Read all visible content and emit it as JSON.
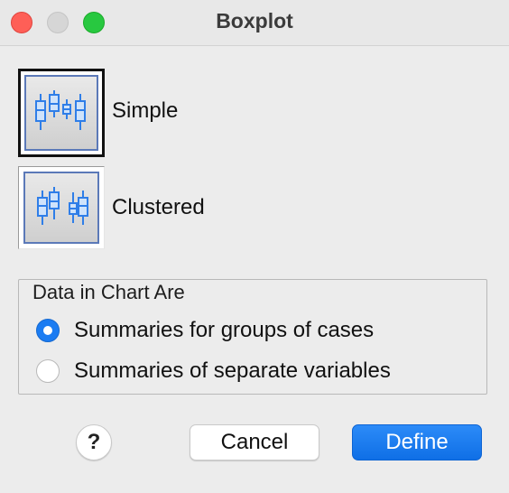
{
  "window": {
    "title": "Boxplot"
  },
  "chart_types": [
    {
      "label": "Simple",
      "selected": true,
      "icon": "simple-boxplot-icon"
    },
    {
      "label": "Clustered",
      "selected": false,
      "icon": "clustered-boxplot-icon"
    }
  ],
  "data_group": {
    "legend": "Data in Chart Are",
    "options": [
      {
        "label": "Summaries for groups of cases",
        "selected": true
      },
      {
        "label": "Summaries of separate variables",
        "selected": false
      }
    ]
  },
  "buttons": {
    "help": "?",
    "cancel": "Cancel",
    "define": "Define"
  },
  "colors": {
    "accent": "#1b7cf2",
    "close": "#fe5f57",
    "zoom": "#28c840",
    "icon_blue": "#2f7ee8"
  }
}
